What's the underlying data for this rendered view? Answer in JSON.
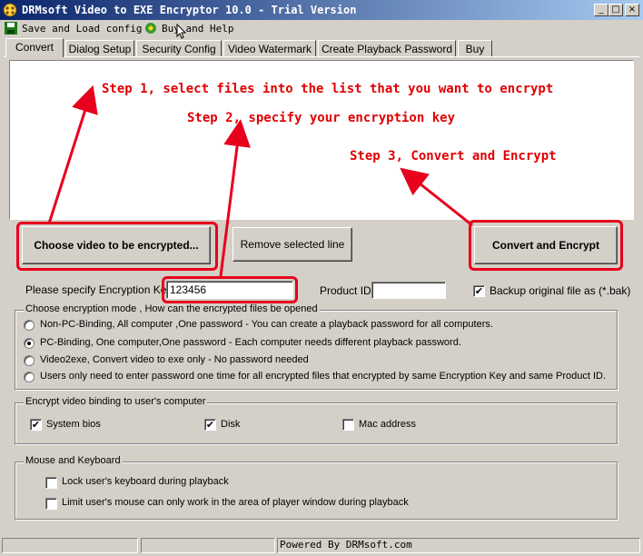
{
  "window": {
    "title": "DRMsoft Video to EXE Encryptor 10.0 - Trial Version",
    "minimize_glyph": "_",
    "maximize_glyph": "□",
    "close_glyph": "×"
  },
  "menu": {
    "save_load": "Save and Load config",
    "buy_help": "Buy and Help"
  },
  "tabs": [
    {
      "label": "Convert"
    },
    {
      "label": "Dialog Setup"
    },
    {
      "label": "Security Config"
    },
    {
      "label": "Video Watermark"
    },
    {
      "label": "Create Playback Password"
    },
    {
      "label": "Buy"
    }
  ],
  "steps": {
    "step1": "Step 1, select files into the list that you want to encrypt",
    "step2": "Step 2, specify your encryption key",
    "step3": "Step 3, Convert and Encrypt"
  },
  "buttons": {
    "choose": "Choose video to be encrypted...",
    "remove": "Remove selected line",
    "convert": "Convert and Encrypt"
  },
  "key": {
    "label": "Please specify Encryption Key",
    "value": "123456",
    "product_label": "Product ID",
    "product_value": "",
    "backup_label": "Backup original file as (*.bak)",
    "backup_checked": true
  },
  "mode": {
    "legend": "Choose encryption mode , How can the encrypted files be opened",
    "options": [
      {
        "label": "Non-PC-Binding, All computer ,One password  - You can create a playback password for all computers.",
        "selected": false
      },
      {
        "label": "PC-Binding, One computer,One password  - Each computer needs different playback password.",
        "selected": true
      },
      {
        "label": "Video2exe, Convert video to exe only  - No password needed",
        "selected": false
      },
      {
        "label": "Users only need to enter password one time for all encrypted files that encrypted by same Encryption Key and same Product ID.",
        "selected": false
      }
    ]
  },
  "binding": {
    "legend": "Encrypt video binding to user's computer",
    "items": [
      {
        "label": "System bios",
        "checked": true
      },
      {
        "label": "Disk",
        "checked": true
      },
      {
        "label": "Mac address",
        "checked": false
      }
    ]
  },
  "mouse": {
    "legend": "Mouse and Keyboard",
    "items": [
      {
        "label": "Lock user's keyboard during playback",
        "checked": false
      },
      {
        "label": "Limit user's mouse can only work in the area of player window during playback",
        "checked": false
      }
    ]
  },
  "status": {
    "text": "Powered By DRMsoft.com"
  },
  "colors": {
    "accent_red": "#e8001c",
    "step_red": "#e00000",
    "title_gradient_start": "#0a246a",
    "title_gradient_end": "#a6caf0"
  }
}
